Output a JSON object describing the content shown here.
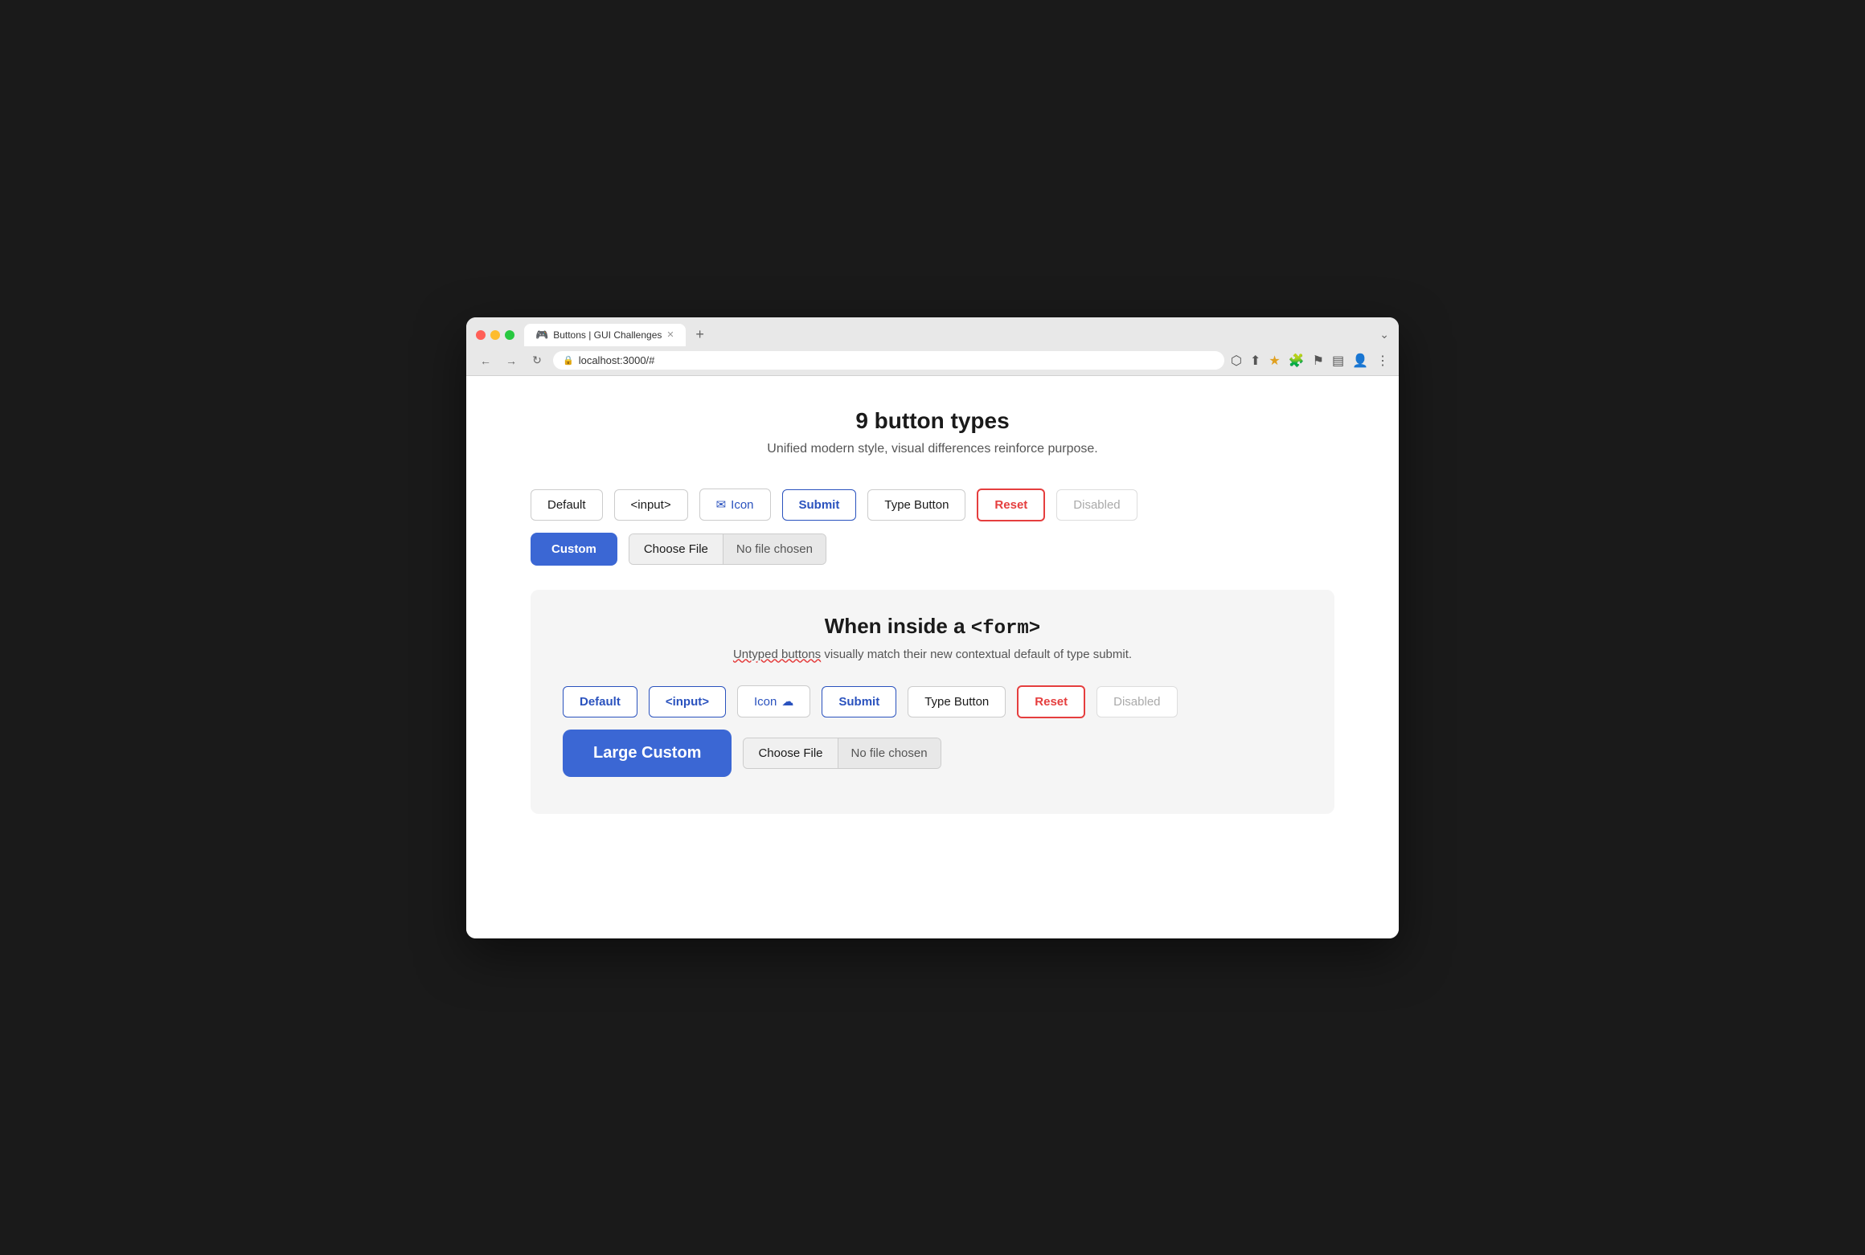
{
  "browser": {
    "tab_title": "Buttons | GUI Challenges",
    "tab_icon": "🎮",
    "url": "localhost:3000/#",
    "new_tab_label": "+",
    "chevron_label": "⌄"
  },
  "nav": {
    "back": "←",
    "forward": "→",
    "reload": "↻",
    "lock": "🔒"
  },
  "toolbar": {
    "external": "⬡",
    "share": "⬆",
    "star": "★",
    "extension": "🧩",
    "flag": "⚑",
    "sidebar": "▤",
    "profile": "👤",
    "menu": "⋮"
  },
  "page": {
    "title": "9 button types",
    "subtitle": "Unified modern style, visual differences reinforce purpose."
  },
  "buttons_row1": {
    "default_label": "Default",
    "input_label": "<input>",
    "icon_label": "Icon",
    "submit_label": "Submit",
    "type_button_label": "Type Button",
    "reset_label": "Reset",
    "disabled_label": "Disabled"
  },
  "buttons_row2": {
    "custom_label": "Custom",
    "choose_file_label": "Choose File",
    "no_file_label": "No file chosen"
  },
  "form_section": {
    "title_prefix": "When inside a ",
    "title_code": "<form>",
    "subtitle_normal": " visually match their new contextual default of type submit.",
    "subtitle_underline": "Untyped buttons"
  },
  "form_buttons_row1": {
    "default_label": "Default",
    "input_label": "<input>",
    "icon_label": "Icon",
    "submit_label": "Submit",
    "type_button_label": "Type Button",
    "reset_label": "Reset",
    "disabled_label": "Disabled"
  },
  "form_buttons_row2": {
    "large_custom_label": "Large Custom",
    "choose_file_label": "Choose File",
    "no_file_label": "No file chosen"
  },
  "icons": {
    "mail": "✉",
    "cloud": "☁"
  }
}
